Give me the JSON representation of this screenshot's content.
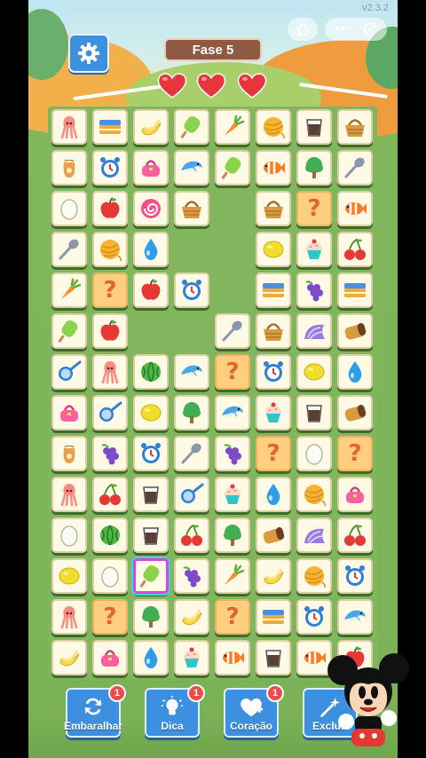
{
  "status": {
    "version": "v2.3.2"
  },
  "header": {
    "level_label": "Fase 5",
    "lives": 3
  },
  "board": {
    "tiles": [
      {
        "r": 0,
        "c": 0,
        "icon": "squid-icon"
      },
      {
        "r": 0,
        "c": 1,
        "icon": "cake-box-icon"
      },
      {
        "r": 0,
        "c": 2,
        "icon": "banana-icon"
      },
      {
        "r": 0,
        "c": 3,
        "icon": "popsicle-icon"
      },
      {
        "r": 0,
        "c": 4,
        "icon": "carrot-icon"
      },
      {
        "r": 0,
        "c": 5,
        "icon": "yarn-ball-icon"
      },
      {
        "r": 0,
        "c": 6,
        "icon": "cup-icon"
      },
      {
        "r": 0,
        "c": 7,
        "icon": "basket-icon"
      },
      {
        "r": 1,
        "c": 0,
        "icon": "sack-icon"
      },
      {
        "r": 1,
        "c": 1,
        "icon": "alarm-clock-icon"
      },
      {
        "r": 1,
        "c": 2,
        "icon": "handbag-icon"
      },
      {
        "r": 1,
        "c": 3,
        "icon": "dolphin-icon"
      },
      {
        "r": 1,
        "c": 4,
        "icon": "popsicle-icon"
      },
      {
        "r": 1,
        "c": 5,
        "icon": "clownfish-icon"
      },
      {
        "r": 1,
        "c": 6,
        "icon": "tree-icon"
      },
      {
        "r": 1,
        "c": 7,
        "icon": "spoon-icon"
      },
      {
        "r": 2,
        "c": 0,
        "icon": "egg-icon"
      },
      {
        "r": 2,
        "c": 1,
        "icon": "apple-icon"
      },
      {
        "r": 2,
        "c": 2,
        "icon": "candy-icon"
      },
      {
        "r": 2,
        "c": 3,
        "icon": "basket-icon"
      },
      {
        "r": 2,
        "c": 5,
        "icon": "basket-icon"
      },
      {
        "r": 2,
        "c": 6,
        "icon": "mystery-icon"
      },
      {
        "r": 2,
        "c": 7,
        "icon": "clownfish-icon"
      },
      {
        "r": 3,
        "c": 0,
        "icon": "spoon-icon"
      },
      {
        "r": 3,
        "c": 1,
        "icon": "yarn-ball-icon"
      },
      {
        "r": 3,
        "c": 2,
        "icon": "water-drop-icon"
      },
      {
        "r": 3,
        "c": 5,
        "icon": "lemon-icon"
      },
      {
        "r": 3,
        "c": 6,
        "icon": "cupcake-icon"
      },
      {
        "r": 3,
        "c": 7,
        "icon": "cherry-icon"
      },
      {
        "r": 4,
        "c": 0,
        "icon": "carrot-icon"
      },
      {
        "r": 4,
        "c": 1,
        "icon": "mystery-icon"
      },
      {
        "r": 4,
        "c": 2,
        "icon": "apple-icon"
      },
      {
        "r": 4,
        "c": 3,
        "icon": "alarm-clock-icon"
      },
      {
        "r": 4,
        "c": 5,
        "icon": "cake-box-icon"
      },
      {
        "r": 4,
        "c": 6,
        "icon": "grapes-icon"
      },
      {
        "r": 4,
        "c": 7,
        "icon": "cake-box-icon"
      },
      {
        "r": 5,
        "c": 0,
        "icon": "popsicle-icon"
      },
      {
        "r": 5,
        "c": 1,
        "icon": "apple-icon"
      },
      {
        "r": 5,
        "c": 4,
        "icon": "spoon-icon"
      },
      {
        "r": 5,
        "c": 5,
        "icon": "basket-icon"
      },
      {
        "r": 5,
        "c": 6,
        "icon": "shell-icon"
      },
      {
        "r": 5,
        "c": 7,
        "icon": "bread-icon"
      },
      {
        "r": 6,
        "c": 0,
        "icon": "pan-icon"
      },
      {
        "r": 6,
        "c": 1,
        "icon": "squid-icon"
      },
      {
        "r": 6,
        "c": 2,
        "icon": "melon-icon"
      },
      {
        "r": 6,
        "c": 3,
        "icon": "dolphin-icon"
      },
      {
        "r": 6,
        "c": 4,
        "icon": "mystery-icon"
      },
      {
        "r": 6,
        "c": 5,
        "icon": "alarm-clock-icon"
      },
      {
        "r": 6,
        "c": 6,
        "icon": "lemon-icon"
      },
      {
        "r": 6,
        "c": 7,
        "icon": "water-drop-icon"
      },
      {
        "r": 7,
        "c": 0,
        "icon": "handbag-icon"
      },
      {
        "r": 7,
        "c": 1,
        "icon": "pan-icon"
      },
      {
        "r": 7,
        "c": 2,
        "icon": "lemon-icon"
      },
      {
        "r": 7,
        "c": 3,
        "icon": "tree-icon"
      },
      {
        "r": 7,
        "c": 4,
        "icon": "dolphin-icon"
      },
      {
        "r": 7,
        "c": 5,
        "icon": "cupcake-icon"
      },
      {
        "r": 7,
        "c": 6,
        "icon": "cup-icon"
      },
      {
        "r": 7,
        "c": 7,
        "icon": "bread-icon"
      },
      {
        "r": 8,
        "c": 0,
        "icon": "sack-icon"
      },
      {
        "r": 8,
        "c": 1,
        "icon": "grapes-icon"
      },
      {
        "r": 8,
        "c": 2,
        "icon": "alarm-clock-icon"
      },
      {
        "r": 8,
        "c": 3,
        "icon": "spoon-icon"
      },
      {
        "r": 8,
        "c": 4,
        "icon": "grapes-icon"
      },
      {
        "r": 8,
        "c": 5,
        "icon": "mystery-icon"
      },
      {
        "r": 8,
        "c": 6,
        "icon": "egg-icon"
      },
      {
        "r": 8,
        "c": 7,
        "icon": "mystery-icon"
      },
      {
        "r": 9,
        "c": 0,
        "icon": "squid-icon"
      },
      {
        "r": 9,
        "c": 1,
        "icon": "cherry-icon"
      },
      {
        "r": 9,
        "c": 2,
        "icon": "cup-icon"
      },
      {
        "r": 9,
        "c": 3,
        "icon": "pan-icon"
      },
      {
        "r": 9,
        "c": 4,
        "icon": "cupcake-icon"
      },
      {
        "r": 9,
        "c": 5,
        "icon": "water-drop-icon"
      },
      {
        "r": 9,
        "c": 6,
        "icon": "yarn-ball-icon"
      },
      {
        "r": 9,
        "c": 7,
        "icon": "handbag-icon"
      },
      {
        "r": 10,
        "c": 0,
        "icon": "egg-icon"
      },
      {
        "r": 10,
        "c": 1,
        "icon": "melon-icon"
      },
      {
        "r": 10,
        "c": 2,
        "icon": "cup-icon"
      },
      {
        "r": 10,
        "c": 3,
        "icon": "cherry-icon"
      },
      {
        "r": 10,
        "c": 4,
        "icon": "tree-icon"
      },
      {
        "r": 10,
        "c": 5,
        "icon": "bread-icon"
      },
      {
        "r": 10,
        "c": 6,
        "icon": "shell-icon"
      },
      {
        "r": 10,
        "c": 7,
        "icon": "cherry-icon"
      },
      {
        "r": 11,
        "c": 0,
        "icon": "lemon-icon"
      },
      {
        "r": 11,
        "c": 1,
        "icon": "egg-icon"
      },
      {
        "r": 11,
        "c": 2,
        "icon": "popsicle-icon",
        "selected": true
      },
      {
        "r": 11,
        "c": 3,
        "icon": "grapes-icon"
      },
      {
        "r": 11,
        "c": 4,
        "icon": "carrot-icon"
      },
      {
        "r": 11,
        "c": 5,
        "icon": "banana-icon"
      },
      {
        "r": 11,
        "c": 6,
        "icon": "yarn-ball-icon"
      },
      {
        "r": 11,
        "c": 7,
        "icon": "alarm-clock-icon"
      },
      {
        "r": 12,
        "c": 0,
        "icon": "squid-icon"
      },
      {
        "r": 12,
        "c": 1,
        "icon": "mystery-icon"
      },
      {
        "r": 12,
        "c": 2,
        "icon": "tree-icon"
      },
      {
        "r": 12,
        "c": 3,
        "icon": "banana-icon"
      },
      {
        "r": 12,
        "c": 4,
        "icon": "mystery-icon"
      },
      {
        "r": 12,
        "c": 5,
        "icon": "cake-box-icon"
      },
      {
        "r": 12,
        "c": 6,
        "icon": "alarm-clock-icon"
      },
      {
        "r": 12,
        "c": 7,
        "icon": "dolphin-icon"
      },
      {
        "r": 13,
        "c": 0,
        "icon": "banana-icon"
      },
      {
        "r": 13,
        "c": 1,
        "icon": "handbag-icon"
      },
      {
        "r": 13,
        "c": 2,
        "icon": "water-drop-icon"
      },
      {
        "r": 13,
        "c": 3,
        "icon": "cupcake-icon"
      },
      {
        "r": 13,
        "c": 4,
        "icon": "clownfish-icon"
      },
      {
        "r": 13,
        "c": 5,
        "icon": "cup-icon"
      },
      {
        "r": 13,
        "c": 6,
        "icon": "clownfish-icon"
      },
      {
        "r": 13,
        "c": 7,
        "icon": "apple-icon"
      }
    ]
  },
  "powerups": [
    {
      "name": "shuffle-button",
      "label": "Embaralhar",
      "badge": "1",
      "icon": "shuffle-icon"
    },
    {
      "name": "hint-button",
      "label": "Dica",
      "badge": "1",
      "icon": "lightbulb-icon"
    },
    {
      "name": "heart-button",
      "label": "Coração",
      "badge": "1",
      "icon": "heart-plus-icon"
    },
    {
      "name": "remove-button",
      "label": "Excluir",
      "badge": "",
      "icon": "magic-wand-icon"
    }
  ],
  "colors": {
    "accent": "#3d8fe0",
    "tile": "#fffae6",
    "mystery_tile": "#ffce7e",
    "heart": "#e8343b",
    "level_label": "#8f5a44"
  }
}
